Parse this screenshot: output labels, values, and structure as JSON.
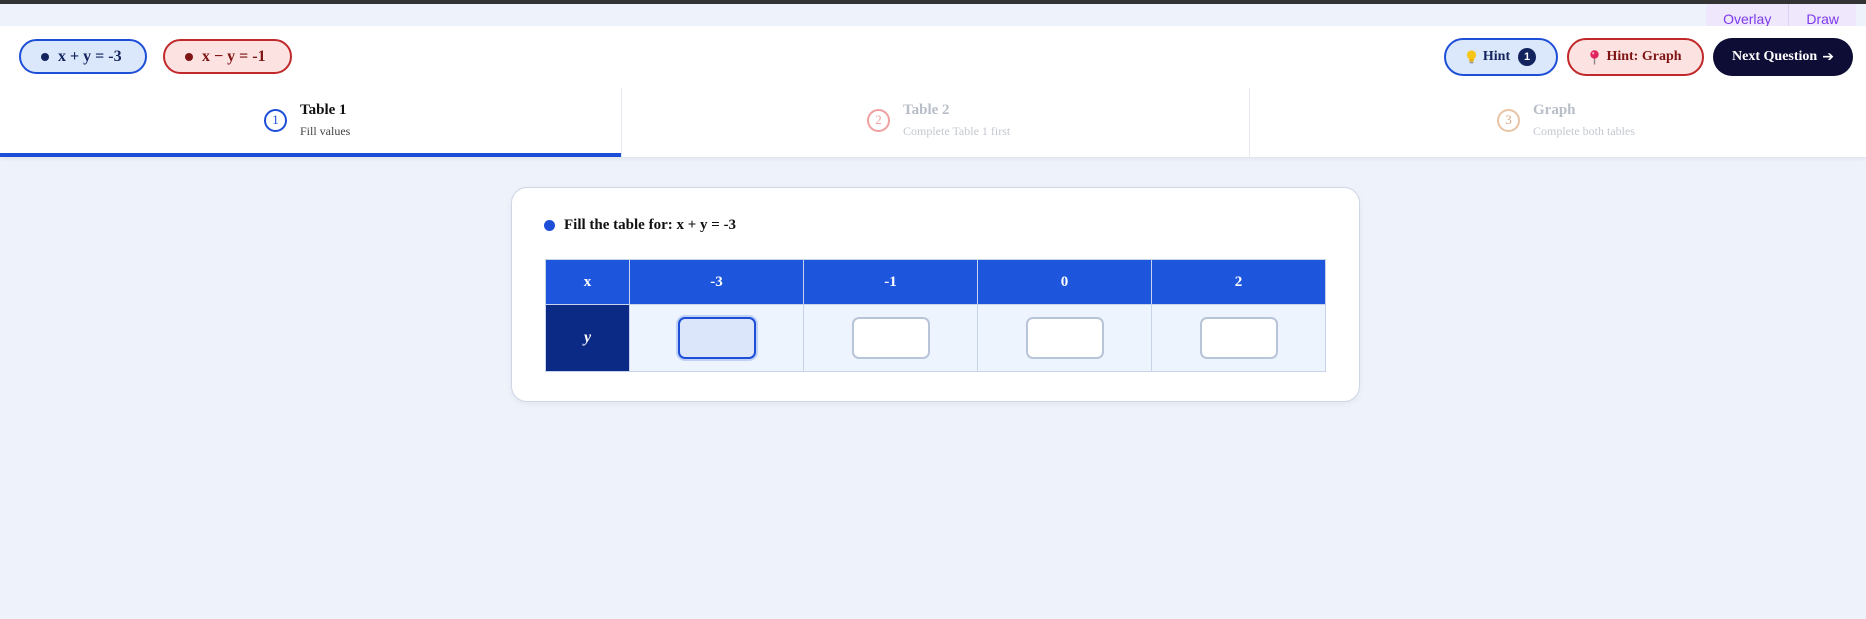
{
  "corner_tools": {
    "overlay": "Overlay",
    "draw": "Draw"
  },
  "equations": [
    {
      "label": "x + y = -3",
      "color": "#1d4ed8"
    },
    {
      "label": "x − y = -1",
      "color": "#c0282a"
    }
  ],
  "buttons": {
    "hint": "Hint",
    "hint_count": "1",
    "hint_graph": "Hint: Graph",
    "next": "Next Question"
  },
  "steps": [
    {
      "number": "1",
      "title": "Table 1",
      "subtitle": "Fill values",
      "state": "active"
    },
    {
      "number": "2",
      "title": "Table 2",
      "subtitle": "Complete Table 1 first",
      "state": "locked"
    },
    {
      "number": "3",
      "title": "Graph",
      "subtitle": "Complete both tables",
      "state": "locked"
    }
  ],
  "card": {
    "title": "Fill the table for: x + y = -3",
    "table": {
      "x_header": "x",
      "y_header": "y",
      "x_values": [
        "-3",
        "-1",
        "0",
        "2"
      ],
      "y_values": [
        "",
        "",
        "",
        ""
      ]
    }
  },
  "colors": {
    "primary": "#1d4ed8",
    "danger": "#c0282a",
    "dark": "#0d0d35",
    "background": "#eef2fa"
  }
}
